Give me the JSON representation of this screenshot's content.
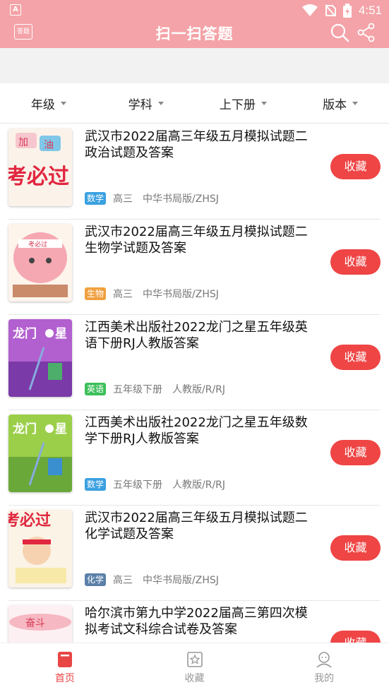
{
  "status_bar": {
    "app_badge": "A",
    "time": "4:51"
  },
  "header": {
    "logo_text": "答题",
    "title": "扫一扫答题"
  },
  "filters": [
    {
      "label": "年级"
    },
    {
      "label": "学科"
    },
    {
      "label": "上下册"
    },
    {
      "label": "版本"
    }
  ],
  "colors": {
    "header_bg": "#f4a3a8",
    "favorite_button": "#ef4545",
    "active_tab": "#e94545"
  },
  "items": [
    {
      "title": "武汉市2022届高三年级五月模拟试题二政治试题及答案",
      "tag": "数学",
      "tag_color": "#3aa0e0",
      "grade": "高三",
      "edition": "中华书局版/ZHSJ",
      "button": "收藏",
      "thumb_text": "加油 考必过"
    },
    {
      "title": "武汉市2022届高三年级五月模拟试题二生物学试题及答案",
      "tag": "生物",
      "tag_color": "#f0a040",
      "grade": "高三",
      "edition": "中华书局版/ZHSJ",
      "button": "收藏",
      "thumb_text": "考必过"
    },
    {
      "title": "江西美术出版社2022龙门之星五年级英语下册RJ人教版答案",
      "tag": "英语",
      "tag_color": "#3cbf5a",
      "grade": "五年级下册",
      "edition": "人教版/R/RJ",
      "button": "收藏",
      "thumb_text": "龙门之星"
    },
    {
      "title": "江西美术出版社2022龙门之星五年级数学下册RJ人教版答案",
      "tag": "数学",
      "tag_color": "#3aa0e0",
      "grade": "五年级下册",
      "edition": "人教版/R/RJ",
      "button": "收藏",
      "thumb_text": "龙门之星"
    },
    {
      "title": "武汉市2022届高三年级五月模拟试题二化学试题及答案",
      "tag": "化学",
      "tag_color": "#5a7fa8",
      "grade": "高三",
      "edition": "中华书局版/ZHSJ",
      "button": "收藏",
      "thumb_text": "考必过"
    },
    {
      "title": "哈尔滨市第九中学2022届高三第四次模拟考试文科综合试卷及答案",
      "tag": "",
      "tag_color": "#3aa0e0",
      "grade": "",
      "edition": "",
      "button": "收藏",
      "thumb_text": "奋斗"
    }
  ],
  "tabs": [
    {
      "label": "首页",
      "icon": "book-icon",
      "active": true
    },
    {
      "label": "收藏",
      "icon": "star-icon",
      "active": false
    },
    {
      "label": "我的",
      "icon": "user-icon",
      "active": false
    }
  ]
}
